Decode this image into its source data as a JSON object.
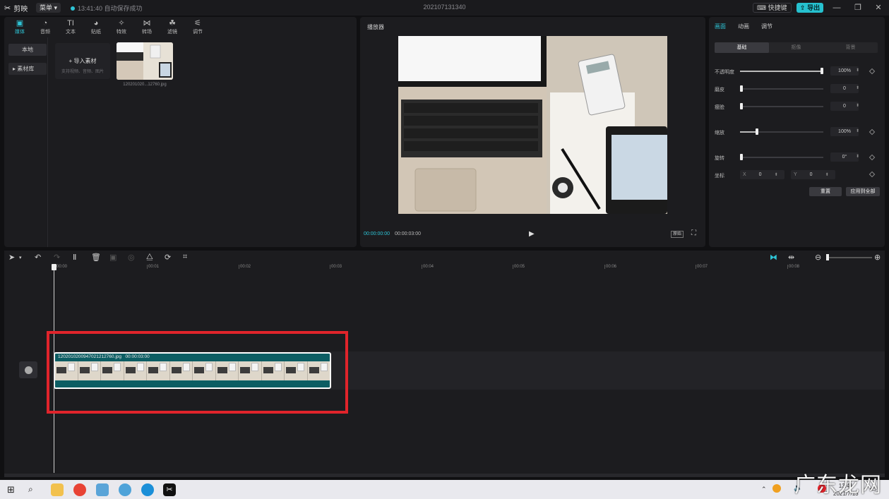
{
  "app": {
    "logo_text": "剪映",
    "menu_label": "菜单",
    "autosave_text": "13:41:40 自动保存成功",
    "project_title": "202107131340",
    "shortcut_label": "快捷键",
    "export_label": "导出"
  },
  "media": {
    "tabs": [
      {
        "icon": "media-icon",
        "label": "媒体",
        "active": true
      },
      {
        "icon": "audio-icon",
        "label": "音频"
      },
      {
        "icon": "text-icon",
        "label": "文本"
      },
      {
        "icon": "sticker-icon",
        "label": "贴纸"
      },
      {
        "icon": "effects-icon",
        "label": "特效"
      },
      {
        "icon": "transition-icon",
        "label": "转场"
      },
      {
        "icon": "filter-icon",
        "label": "滤镜"
      },
      {
        "icon": "adjust-icon",
        "label": "调节"
      }
    ],
    "side_local": "本地",
    "side_library": "素材库",
    "import_label": "导入素材",
    "import_hint": "支持视频、音频、图片",
    "thumb_name": "120201020...12760.jpg"
  },
  "player": {
    "title": "播放器",
    "time_current": "00:00:00:00",
    "time_total": "00:00:03:00",
    "ratio_label": "原始"
  },
  "inspector": {
    "tabs": [
      "画面",
      "动画",
      "调节"
    ],
    "subtabs": [
      "基础",
      "抠像",
      "背景"
    ],
    "opacity_label": "不透明度",
    "opacity_value": "100%",
    "opacity_level": 1.0,
    "smooth_label": "磨皮",
    "smooth_value": "0",
    "slim_label": "瘦脸",
    "slim_value": "0",
    "scale_label": "缩放",
    "scale_value": "100%",
    "scale_level": 0.2,
    "rotate_label": "旋转",
    "rotate_value": "0°",
    "position_label": "坐标",
    "x_label": "X",
    "x_value": "0",
    "y_label": "Y",
    "y_value": "0",
    "reset_label": "重置",
    "apply_all_label": "应用到全部"
  },
  "timeline": {
    "ticks": [
      "00:00",
      "00:01",
      "00:02",
      "00:03",
      "00:04",
      "00:05",
      "00:06",
      "00:07",
      "00:08"
    ],
    "clip_name": "1202010200947021212760.jpg",
    "clip_duration": "00:00:03:00"
  },
  "taskbar": {
    "time": "13:41",
    "date": "2021/7/13"
  },
  "watermark": "广东龙网",
  "colors": {
    "accent": "#2ec4d6",
    "clip": "#0c5d63",
    "highlight": "#e0242b"
  }
}
